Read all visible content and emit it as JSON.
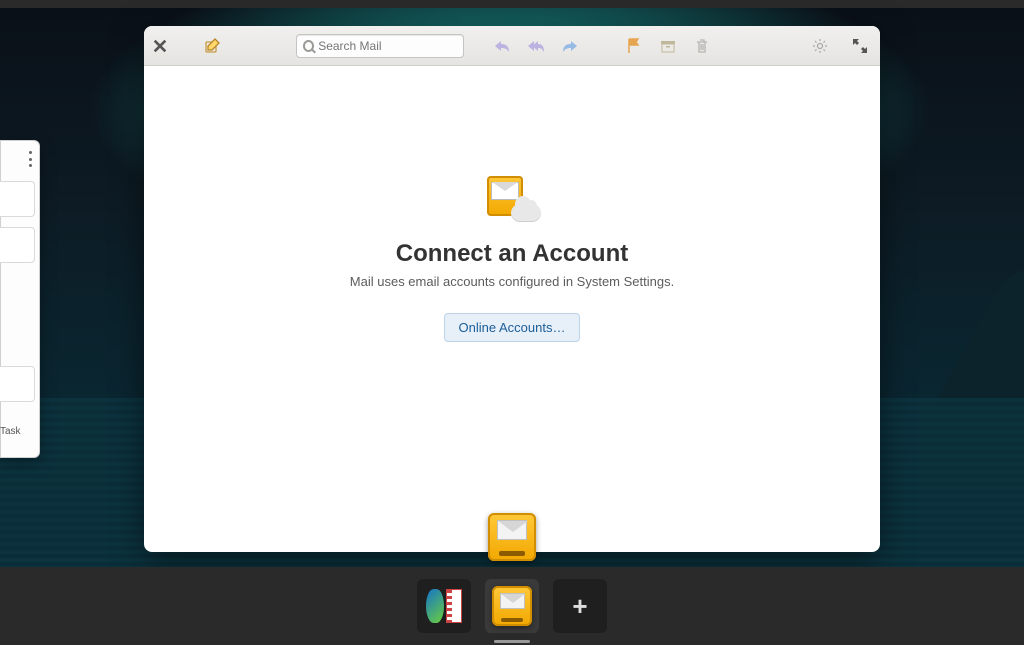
{
  "toolbar": {
    "search_placeholder": "Search Mail"
  },
  "empty_state": {
    "heading": "Connect an Account",
    "subtext": "Mail uses email accounts configured in System Settings.",
    "button_label": "Online Accounts…"
  },
  "peek_window": {
    "bottom_label": "Id Task"
  }
}
